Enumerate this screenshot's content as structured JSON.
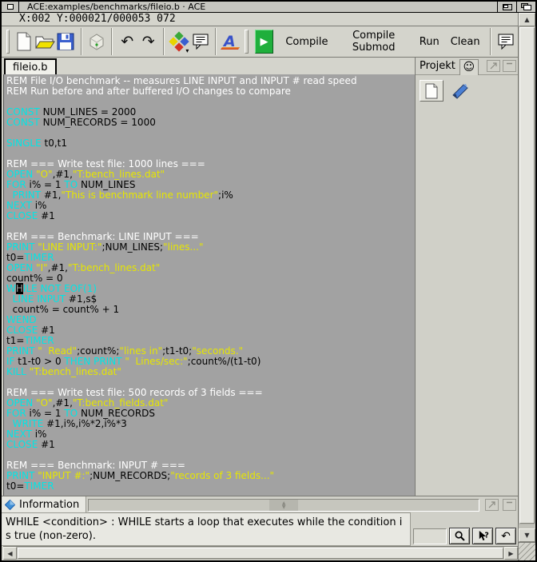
{
  "window": {
    "title": "ACE:examples/benchmarks/fileio.b · ACE",
    "status": "X:002 Y:000021/000053 072"
  },
  "toolbar": {
    "text_buttons": [
      "Compile",
      "Compile Submod",
      "Run",
      "Clean"
    ]
  },
  "tab": "fileio.b",
  "project": {
    "title": "Projekt"
  },
  "info": {
    "title": "Information",
    "text": "WHILE <condition> : WHILE starts a loop that executes while the condition is true (non-zero)."
  },
  "icons": {
    "up": "▲",
    "down": "▼",
    "left": "◀",
    "right": "▶",
    "smiley": "☺",
    "undo": "↶",
    "redo": "↷",
    "play": "▶",
    "dropdown": "▾",
    "revert": "↶"
  },
  "colors": {
    "editor_bg": "#a2a2a2",
    "keyword": "#00e6e6",
    "string": "#e6e600",
    "comment": "#ffffff",
    "plain": "#000000",
    "run_green": "#1faf3c",
    "ace_blue": "#3952c8",
    "bookmark_blue": "#4a7fd4",
    "info_diamond_blue": "#3f8fd6"
  },
  "code": {
    "lines": [
      [
        [
          "c",
          "REM File I/O benchmark -- measures LINE INPUT and INPUT # read speed"
        ]
      ],
      [
        [
          "c",
          "REM Run before and after buffered I/O changes to compare"
        ]
      ],
      [],
      [
        [
          "k",
          "CONST"
        ],
        [
          "p",
          " NUM_LINES = 2000"
        ]
      ],
      [
        [
          "k",
          "CONST"
        ],
        [
          "p",
          " NUM_RECORDS = 1000"
        ]
      ],
      [],
      [
        [
          "k",
          "SINGLE"
        ],
        [
          "p",
          " t0,t1"
        ]
      ],
      [],
      [
        [
          "c",
          "REM === Write test file: 1000 lines ==="
        ]
      ],
      [
        [
          "k",
          "OPEN"
        ],
        [
          "p",
          " "
        ],
        [
          "s",
          "\"O\""
        ],
        [
          "p",
          ",#1,"
        ],
        [
          "s",
          "\"T:bench_lines.dat\""
        ]
      ],
      [
        [
          "k",
          "FOR"
        ],
        [
          "p",
          " i% = 1 "
        ],
        [
          "k",
          "TO"
        ],
        [
          "p",
          " NUM_LINES"
        ]
      ],
      [
        [
          "p",
          "  "
        ],
        [
          "k",
          "PRINT"
        ],
        [
          "p",
          " #1,"
        ],
        [
          "s",
          "\"This is benchmark line number\""
        ],
        [
          "p",
          ";i%"
        ]
      ],
      [
        [
          "k",
          "NEXT"
        ],
        [
          "p",
          " i%"
        ]
      ],
      [
        [
          "k",
          "CLOSE"
        ],
        [
          "p",
          " #1"
        ]
      ],
      [],
      [
        [
          "c",
          "REM === Benchmark: LINE INPUT ==="
        ]
      ],
      [
        [
          "k",
          "PRINT"
        ],
        [
          "p",
          " "
        ],
        [
          "s",
          "\"LINE INPUT:\""
        ],
        [
          "p",
          ";NUM_LINES;"
        ],
        [
          "s",
          "\"lines...\""
        ]
      ],
      [
        [
          "p",
          "t0="
        ],
        [
          "k",
          "TIMER"
        ]
      ],
      [
        [
          "k",
          "OPEN"
        ],
        [
          "p",
          " "
        ],
        [
          "s",
          "\"I\""
        ],
        [
          "p",
          ",#1,"
        ],
        [
          "s",
          "\"T:bench_lines.dat\""
        ]
      ],
      [
        [
          "p",
          "count% = 0"
        ]
      ],
      [
        [
          "k",
          "W"
        ],
        [
          "x",
          "H"
        ],
        [
          "k",
          "ILE NOT EOF(1)"
        ]
      ],
      [
        [
          "p",
          "  "
        ],
        [
          "k",
          "LINE INPUT"
        ],
        [
          "p",
          " #1,s$"
        ]
      ],
      [
        [
          "p",
          "  count% = count% + 1"
        ]
      ],
      [
        [
          "k",
          "WEND"
        ]
      ],
      [
        [
          "k",
          "CLOSE"
        ],
        [
          "p",
          " #1"
        ]
      ],
      [
        [
          "p",
          "t1="
        ],
        [
          "k",
          "TIMER"
        ]
      ],
      [
        [
          "k",
          "PRINT"
        ],
        [
          "p",
          " "
        ],
        [
          "s",
          "\"  Read\""
        ],
        [
          "p",
          ";count%;"
        ],
        [
          "s",
          "\"lines in\""
        ],
        [
          "p",
          ";t1-t0;"
        ],
        [
          "s",
          "\"seconds.\""
        ]
      ],
      [
        [
          "k",
          "IF"
        ],
        [
          "p",
          " t1-t0 > 0 "
        ],
        [
          "k",
          "THEN PRINT"
        ],
        [
          "p",
          " "
        ],
        [
          "s",
          "\"  Lines/sec:\""
        ],
        [
          "p",
          ";count%/(t1-t0)"
        ]
      ],
      [
        [
          "k",
          "KILL"
        ],
        [
          "p",
          " "
        ],
        [
          "s",
          "\"T:bench_lines.dat\""
        ]
      ],
      [],
      [
        [
          "c",
          "REM === Write test file: 500 records of 3 fields ==="
        ]
      ],
      [
        [
          "k",
          "OPEN"
        ],
        [
          "p",
          " "
        ],
        [
          "s",
          "\"O\""
        ],
        [
          "p",
          ",#1,"
        ],
        [
          "s",
          "\"T:bench_fields.dat\""
        ]
      ],
      [
        [
          "k",
          "FOR"
        ],
        [
          "p",
          " i% = 1 "
        ],
        [
          "k",
          "TO"
        ],
        [
          "p",
          " NUM_RECORDS"
        ]
      ],
      [
        [
          "p",
          "  "
        ],
        [
          "k",
          "WRITE"
        ],
        [
          "p",
          " #1,i%,i%*2,i%*3"
        ]
      ],
      [
        [
          "k",
          "NEXT"
        ],
        [
          "p",
          " i%"
        ]
      ],
      [
        [
          "k",
          "CLOSE"
        ],
        [
          "p",
          " #1"
        ]
      ],
      [],
      [
        [
          "c",
          "REM === Benchmark: INPUT # ==="
        ]
      ],
      [
        [
          "k",
          "PRINT"
        ],
        [
          "p",
          " "
        ],
        [
          "s",
          "\"INPUT #:\""
        ],
        [
          "p",
          ";NUM_RECORDS;"
        ],
        [
          "s",
          "\"records of 3 fields...\""
        ]
      ],
      [
        [
          "p",
          "t0="
        ],
        [
          "k",
          "TIMER"
        ]
      ]
    ]
  }
}
